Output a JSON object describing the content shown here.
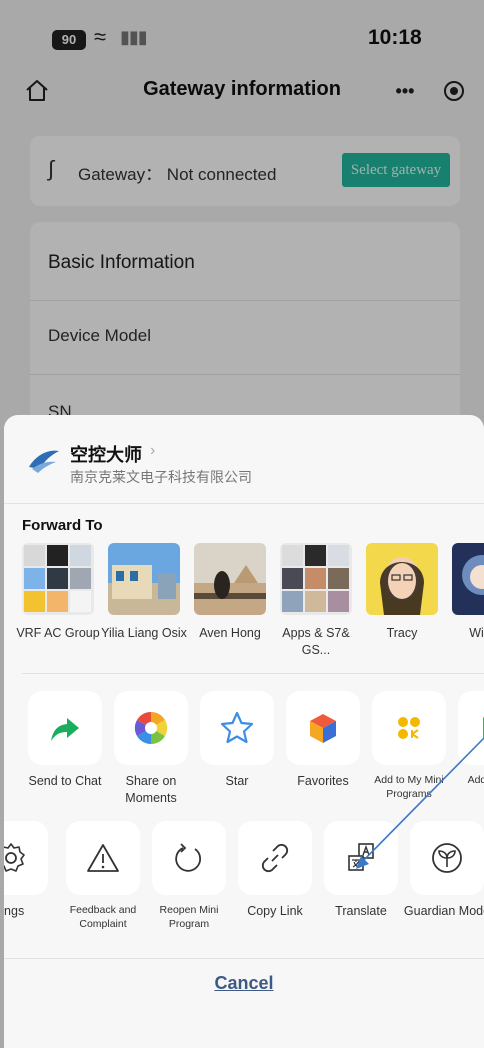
{
  "status_bar": {
    "battery": "90",
    "time": "10:18"
  },
  "nav": {
    "title": "Gateway information",
    "more_label": "•••"
  },
  "gateway": {
    "status_text": "Gateway： Not connected",
    "select_button": "Select gateway"
  },
  "basic_info": {
    "title": "Basic Information",
    "rows": [
      "Device Model",
      "SN"
    ]
  },
  "mini_program": {
    "name": "空控大师",
    "chevron": "›",
    "company": "南京克莱文电子科技有限公司"
  },
  "forward": {
    "title": "Forward To",
    "contacts": [
      {
        "name": "VRF AC Group"
      },
      {
        "name": "Yilia Liang Osix"
      },
      {
        "name": "Aven Hong"
      },
      {
        "name": "Apps & S7& GS..."
      },
      {
        "name": "Tracy"
      },
      {
        "name": "Wir Su"
      }
    ]
  },
  "share_actions": [
    {
      "label": "Send to Chat",
      "icon": "share-arrow-icon",
      "color": "#1aad5f"
    },
    {
      "label": "Share on Moments",
      "icon": "moments-aperture-icon",
      "color": "#f5a623"
    },
    {
      "label": "Star",
      "icon": "star-icon",
      "color": "#3a8ee6"
    },
    {
      "label": "Favorites",
      "icon": "favorites-cube-icon",
      "color": "#e84a3c"
    },
    {
      "label": "Add to My Mini Programs",
      "icon": "mini-program-icon",
      "color": "#f5b800"
    },
    {
      "label": "Add to Scre",
      "icon": "home-screen-icon",
      "color": "#2db84d"
    }
  ],
  "tool_actions": [
    {
      "label": "tings",
      "icon": "settings-gear-icon"
    },
    {
      "label": "Feedback and Complaint",
      "icon": "warning-triangle-icon"
    },
    {
      "label": "Reopen Mini Program",
      "icon": "reload-icon"
    },
    {
      "label": "Copy Link",
      "icon": "link-icon"
    },
    {
      "label": "Translate",
      "icon": "translate-icon"
    },
    {
      "label": "Guardian Mode",
      "icon": "sprout-icon"
    }
  ],
  "cancel_label": "Cancel",
  "colors": {
    "accent_teal": "#22b8a0",
    "cancel_blue": "#3d5a84",
    "annotation_blue": "#3a78c9"
  }
}
